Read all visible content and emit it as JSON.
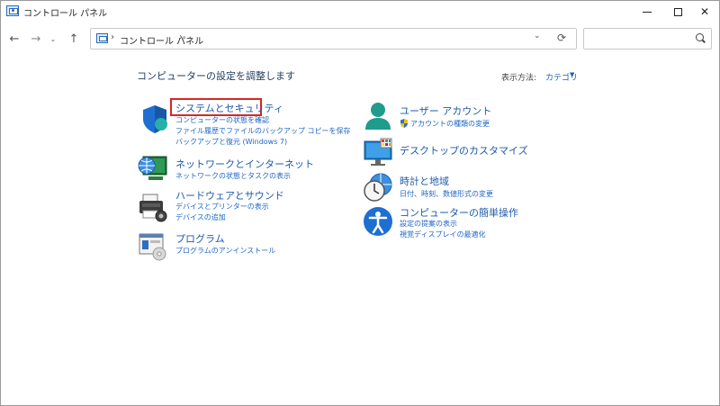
{
  "window": {
    "title": "コントロール パネル",
    "minimize": "—",
    "close": "✕"
  },
  "nav": {
    "back": "←",
    "forward": "→",
    "recent": "⌄",
    "up": "↑",
    "address_sep": "›",
    "address_text": "コントロール パネル",
    "dropdown": "⌄",
    "refresh": "⟳",
    "search_placeholder": ""
  },
  "main": {
    "heading": "コンピューターの設定を調整します",
    "view_by_label": "表示方法:",
    "view_by_value": "カテゴリ",
    "view_caret": "▼"
  },
  "categories": {
    "system_security": {
      "title": "システムとセキュリティ",
      "links": [
        "コンピューターの状態を確認",
        "ファイル履歴でファイルのバックアップ コピーを保存",
        "バックアップと復元 (Windows 7)"
      ]
    },
    "network": {
      "title": "ネットワークとインターネット",
      "links": [
        "ネットワークの状態とタスクの表示"
      ]
    },
    "hardware": {
      "title": "ハードウェアとサウンド",
      "links": [
        "デバイスとプリンターの表示",
        "デバイスの追加"
      ]
    },
    "programs": {
      "title": "プログラム",
      "links": [
        "プログラムのアンインストール"
      ]
    },
    "user_accounts": {
      "title": "ユーザー アカウント",
      "links": [
        "アカウントの種類の変更"
      ]
    },
    "appearance": {
      "title": "デスクトップのカスタマイズ",
      "links": []
    },
    "clock_region": {
      "title": "時計と地域",
      "links": [
        "日付、時刻、数値形式の変更"
      ]
    },
    "ease_of_access": {
      "title": "コンピューターの簡単操作",
      "links": [
        "設定の提案の表示",
        "視覚ディスプレイの最適化"
      ]
    }
  },
  "colors": {
    "highlight": "#d6262b",
    "link": "#1f66c6",
    "title": "#1e5ba8"
  }
}
